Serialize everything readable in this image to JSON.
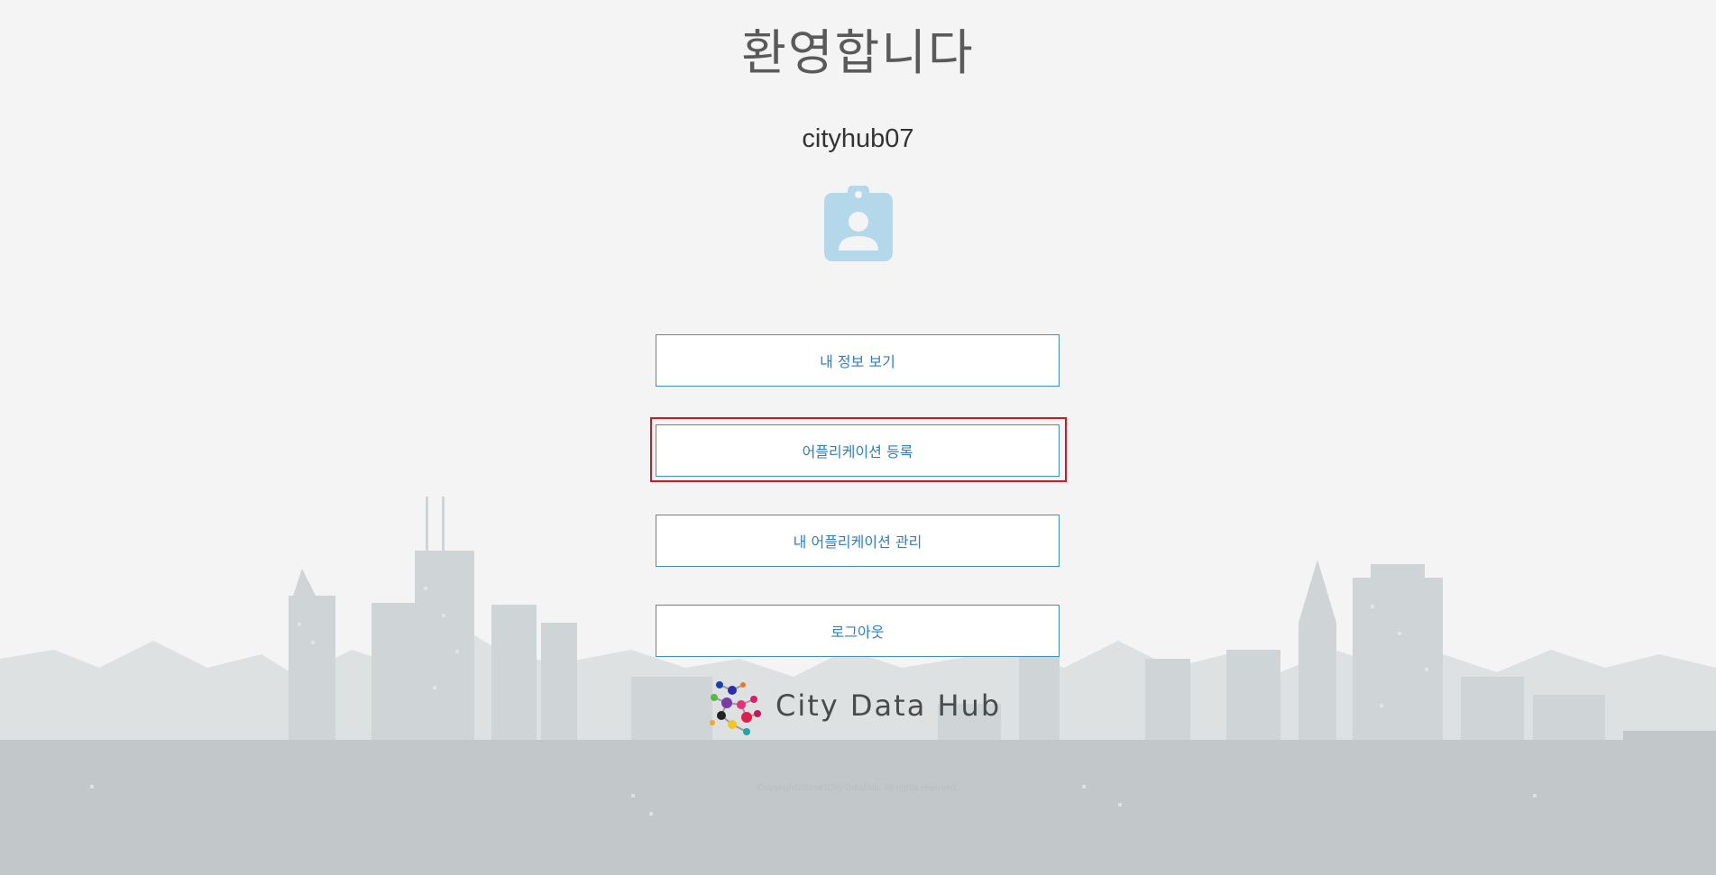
{
  "header": {
    "title": "환영합니다",
    "username": "cityhub07"
  },
  "avatar": {
    "icon": "user-badge-icon",
    "color": "#b3d8ea"
  },
  "menu": {
    "view_info_label": "내 정보 보기",
    "register_app_label": "어플리케이션 등록",
    "manage_apps_label": "내 어플리케이션 관리",
    "logout_label": "로그아웃"
  },
  "brand": {
    "logo_text": "City Data Hub"
  },
  "footer": {
    "copyright": "Copyright©SmartCity Datahub. All rights reserved."
  },
  "colors": {
    "button_border": "#3d8ec9",
    "button_text": "#2e7fc0",
    "highlight": "#d9141e",
    "background": "#f4f4f4"
  }
}
